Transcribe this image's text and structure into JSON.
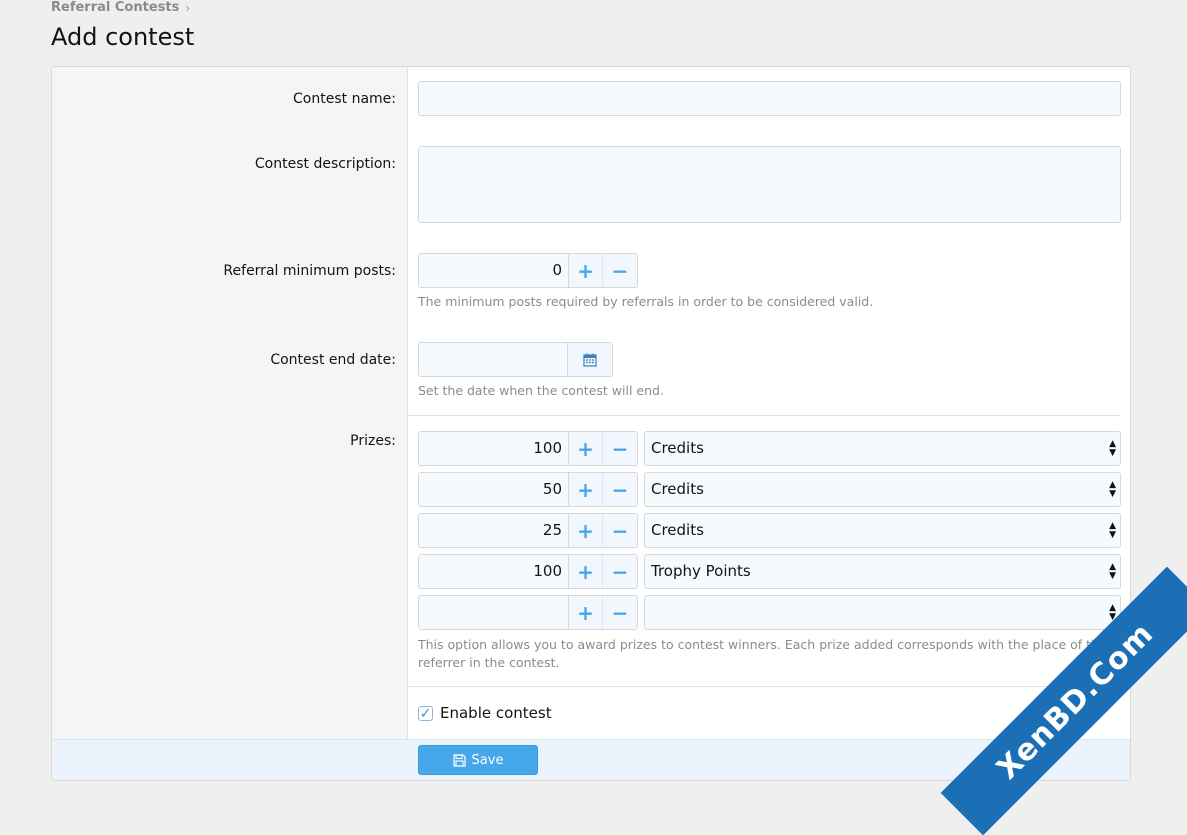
{
  "breadcrumb": {
    "item": "Referral Contests",
    "separator": "›"
  },
  "page": {
    "title": "Add contest"
  },
  "form": {
    "contest_name_label": "Contest name:",
    "contest_name_value": "",
    "description_label": "Contest description:",
    "description_value": "",
    "min_posts_label": "Referral minimum posts:",
    "min_posts_value": "0",
    "min_posts_hint": "The minimum posts required by referrals in order to be considered valid.",
    "end_date_label": "Contest end date:",
    "end_date_value": "",
    "end_date_hint": "Set the date when the contest will end.",
    "prizes_label": "Prizes:",
    "prizes": [
      {
        "amount": "100",
        "type": "Credits"
      },
      {
        "amount": "50",
        "type": "Credits"
      },
      {
        "amount": "25",
        "type": "Credits"
      },
      {
        "amount": "100",
        "type": "Trophy Points"
      },
      {
        "amount": "",
        "type": ""
      }
    ],
    "prizes_hint": "This option allows you to award prizes to contest winners. Each prize added corresponds with the place of the referrer in the contest.",
    "enable_label": "Enable contest",
    "enable_checked": true,
    "save_label": "Save"
  },
  "icons": {
    "plus": "plus-icon",
    "minus": "minus-icon",
    "calendar": "calendar-icon",
    "save": "save-icon",
    "select_arrows": "select-arrows-icon"
  },
  "watermark": "XenBD.Com",
  "colors": {
    "accent": "#47a7eb",
    "footer": "#eaf3fc"
  }
}
